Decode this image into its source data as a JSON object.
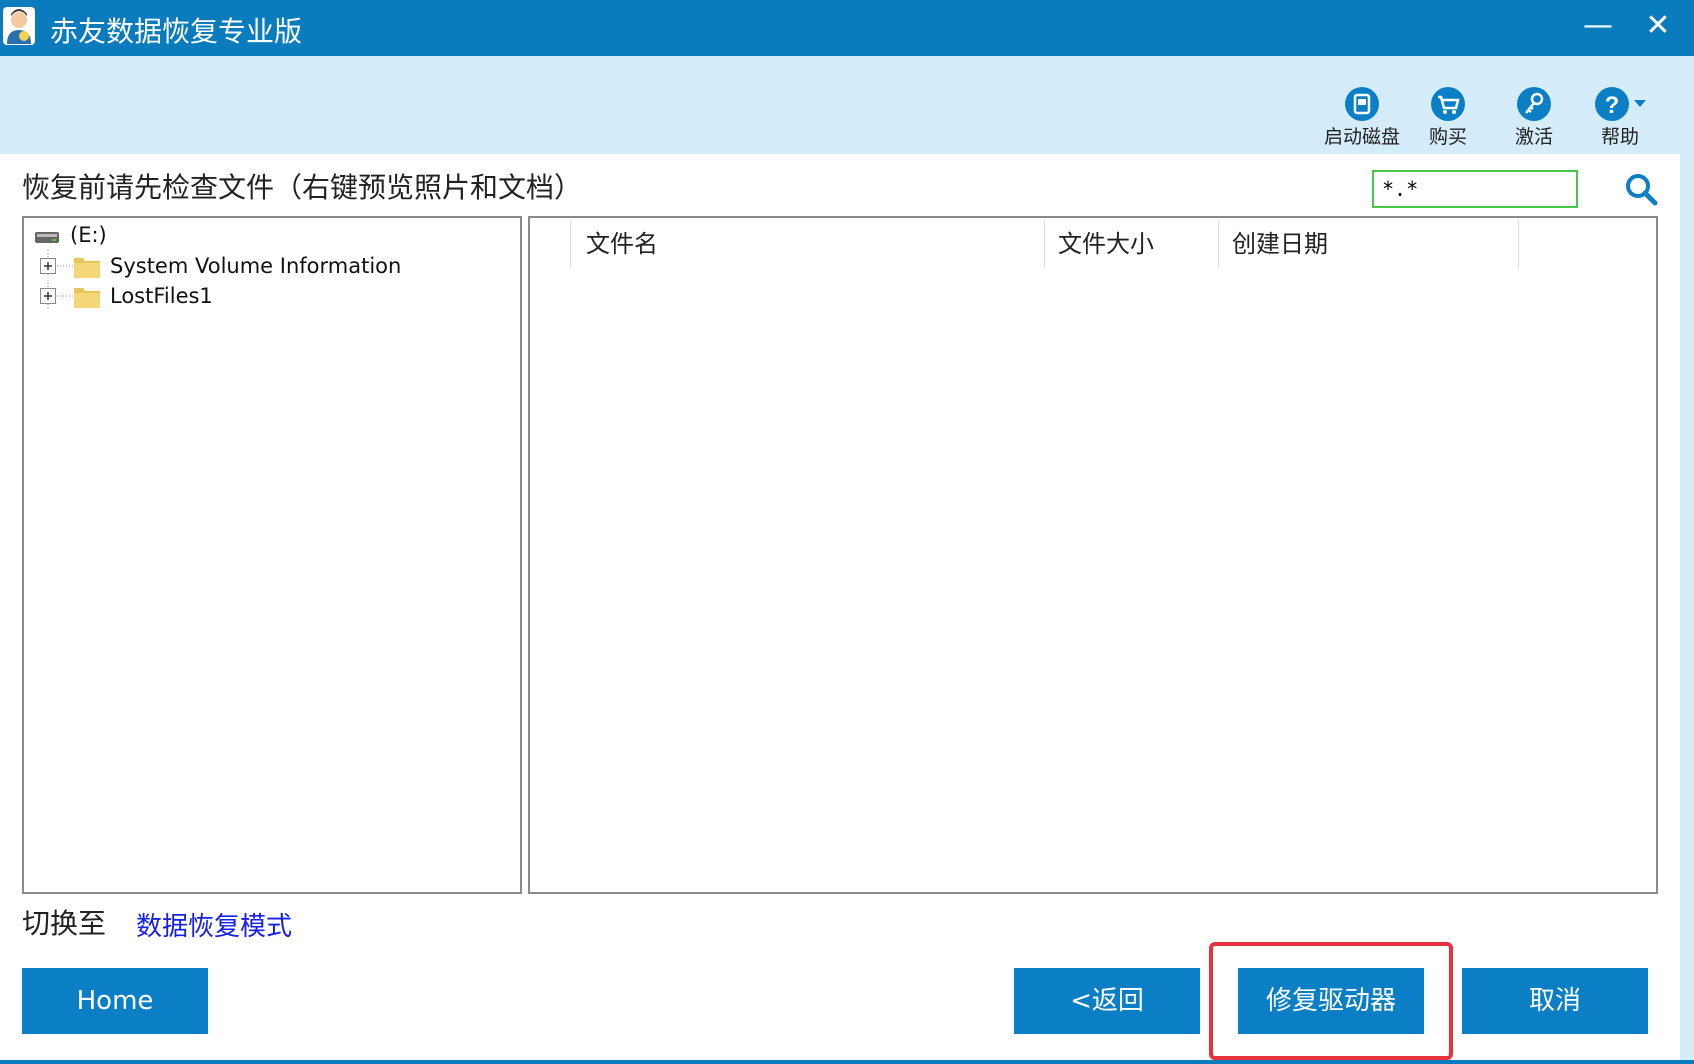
{
  "window": {
    "title": "赤友数据恢复专业版",
    "minimize": "—",
    "close": "✕"
  },
  "toolbar": {
    "items": [
      {
        "label": "启动磁盘",
        "icon": "boot-disk-icon"
      },
      {
        "label": "购买",
        "icon": "cart-icon"
      },
      {
        "label": "激活",
        "icon": "key-icon"
      },
      {
        "label": "帮助",
        "icon": "help-icon"
      }
    ]
  },
  "main": {
    "instruction": "恢复前请先检查文件（右键预览照片和文档）",
    "search_value": "*.*"
  },
  "tree": {
    "root": "(E:)",
    "children": [
      "System Volume Information",
      "LostFiles1"
    ]
  },
  "file_list": {
    "columns": [
      "文件名",
      "文件大小",
      "创建日期"
    ]
  },
  "footer": {
    "switch_label": "切换至",
    "mode_link": "数据恢复模式",
    "home": "Home",
    "back": "<返回",
    "repair": "修复驱动器",
    "cancel": "取消"
  },
  "colors": {
    "titlebar": "#0a7bbd",
    "toolbar_bg": "#d5ecfb",
    "button": "#0b7fc6",
    "highlight": "#e8333f",
    "search_border": "#48c84a"
  }
}
